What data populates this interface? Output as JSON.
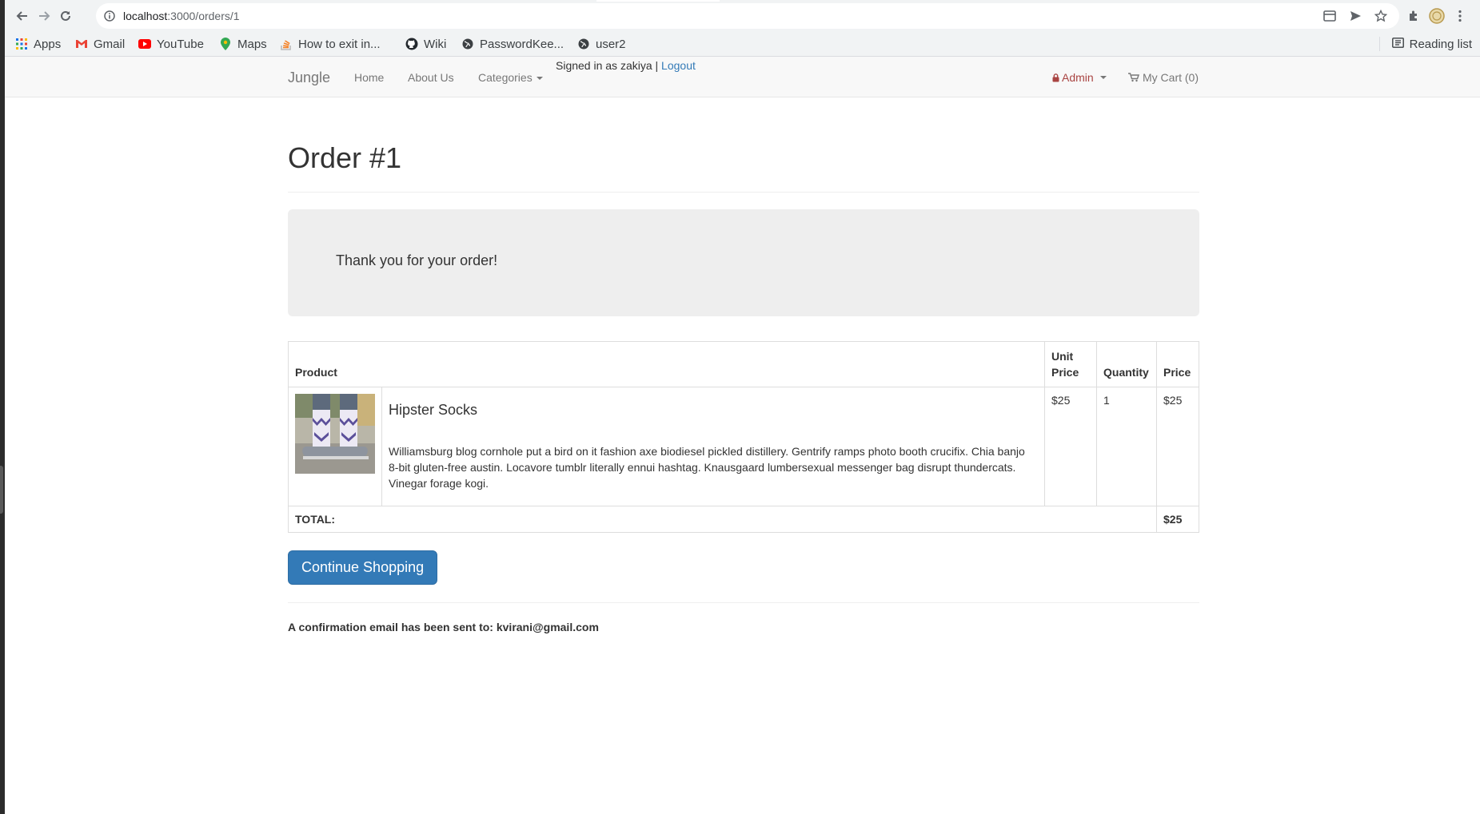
{
  "browser": {
    "url_host": "localhost",
    "url_path": ":3000/orders/1",
    "bookmarks": [
      {
        "label": "Apps",
        "icon": "apps-grid-icon"
      },
      {
        "label": "Gmail",
        "icon": "gmail-icon"
      },
      {
        "label": "YouTube",
        "icon": "youtube-icon"
      },
      {
        "label": "Maps",
        "icon": "maps-icon"
      },
      {
        "label": "How to exit in...",
        "icon": "stackoverflow-icon"
      },
      {
        "label": "Wiki",
        "icon": "github-icon"
      },
      {
        "label": "PasswordKee...",
        "icon": "globe-icon"
      },
      {
        "label": "user2",
        "icon": "globe-icon"
      }
    ],
    "reading_list": "Reading list"
  },
  "navbar": {
    "brand": "Jungle",
    "home": "Home",
    "about": "About Us",
    "categories": "Categories",
    "signed_in_prefix": "Signed in as zakiya | ",
    "logout": "Logout",
    "admin": "Admin",
    "cart": "My Cart (0)"
  },
  "page": {
    "title": "Order #1",
    "thank_you": "Thank you for your order!",
    "continue_button": "Continue Shopping",
    "confirmation": "A confirmation email has been sent to: kvirani@gmail.com"
  },
  "order_table": {
    "headers": {
      "product": "Product",
      "unit_price_1": "Unit",
      "unit_price_2": "Price",
      "quantity": "Quantity",
      "price": "Price"
    },
    "items": [
      {
        "name": "Hipster Socks",
        "description": "Williamsburg blog cornhole put a bird on it fashion axe biodiesel pickled distillery. Gentrify ramps photo booth crucifix. Chia banjo 8-bit gluten-free austin. Locavore tumblr literally ennui hashtag. Knausgaard lumbersexual messenger bag disrupt thundercats. Vinegar forage kogi.",
        "unit_price": "$25",
        "quantity": "1",
        "price": "$25"
      }
    ],
    "total_label": "TOTAL:",
    "total_value": "$25"
  },
  "colors": {
    "link": "#337ab7",
    "button": "#337ab7",
    "admin": "#a94442",
    "jumbotron": "#eeeeee"
  }
}
